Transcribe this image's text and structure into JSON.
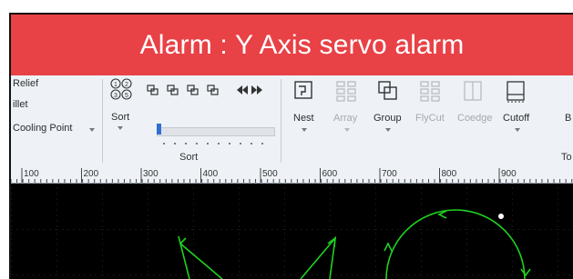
{
  "alarm": {
    "text": "Alarm : Y Axis servo alarm",
    "color": "#e84146"
  },
  "ribbon": {
    "left_items": [
      "Relief",
      "illet",
      "Cooling Point"
    ],
    "sort": {
      "label": "Sort",
      "group_caption": "Sort"
    },
    "tools": [
      {
        "name": "nest",
        "label": "Nest",
        "enabled": true
      },
      {
        "name": "array",
        "label": "Array",
        "enabled": false
      },
      {
        "name": "group",
        "label": "Group",
        "enabled": true
      },
      {
        "name": "flycut",
        "label": "FlyCut",
        "enabled": false
      },
      {
        "name": "coedge",
        "label": "Coedge",
        "enabled": false
      },
      {
        "name": "cutoff",
        "label": "Cutoff",
        "enabled": true
      }
    ],
    "partial_label_b": "B",
    "partial_caption_to": "To"
  },
  "ruler": {
    "ticks": [
      "100",
      "200",
      "300",
      "400",
      "500",
      "600",
      "700",
      "800",
      "900"
    ]
  },
  "canvas": {
    "background": "#000000",
    "path_color": "#1fd11f"
  }
}
